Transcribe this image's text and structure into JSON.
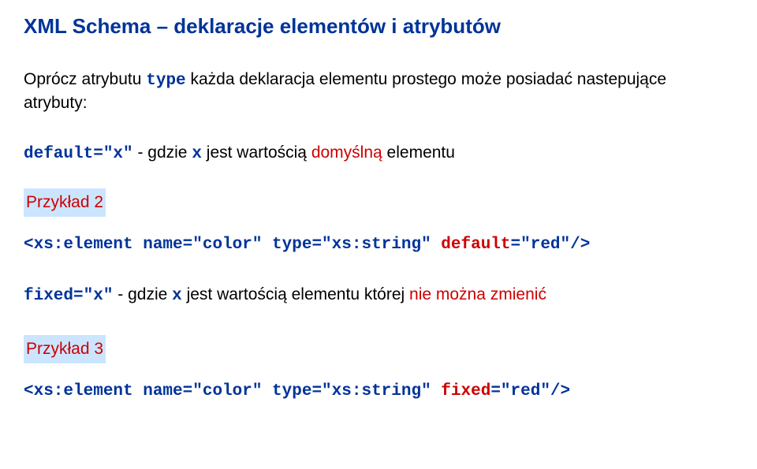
{
  "title": "XML Schema – deklaracje elementów i atrybutów",
  "intro": {
    "part1": "Oprócz atrybutu ",
    "code1": "type",
    "part2": " każda deklaracja elementu prostego może posiadać nastepujące atrybuty:"
  },
  "default_line": {
    "code": "default=\"x\"",
    "part1": " - gdzie ",
    "var": "x",
    "part2": " jest wartością ",
    "emph": "domyślną",
    "part3": " elementu"
  },
  "example2_label": "Przykład 2",
  "example2_code": {
    "prefix": "<xs:element name=\"color\" type=\"xs:string\" ",
    "attr": "default",
    "suffix": "=\"red\"/>"
  },
  "fixed_line": {
    "code": "fixed=\"x\"",
    "part1": " - gdzie ",
    "var": "x",
    "part2": " jest wartością elementu której ",
    "emph": "nie można zmienić"
  },
  "example3_label": "Przykład 3",
  "example3_code": {
    "prefix": "<xs:element name=\"color\" type=\"xs:string\" ",
    "attr": "fixed",
    "suffix": "=\"red\"/>"
  }
}
